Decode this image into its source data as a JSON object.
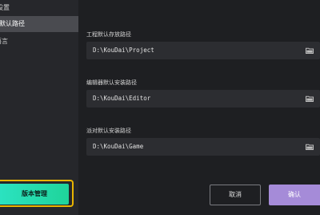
{
  "sidebar": {
    "title": "设置",
    "items": [
      {
        "label": "默认路径",
        "active": true
      },
      {
        "label": "语言",
        "active": false
      }
    ],
    "version_button": "版本管理"
  },
  "main": {
    "fields": [
      {
        "label": "工程默认存放路径",
        "value": "D:\\KouDai\\Project",
        "icon": "folder-icon"
      },
      {
        "label": "编辑器默认安装路径",
        "value": "D:\\KouDai\\Editor",
        "icon": "folder-icon"
      },
      {
        "label": "派对默认安装路径",
        "value": "D:\\KouDai\\Game",
        "icon": "folder-icon"
      }
    ]
  },
  "footer": {
    "cancel_label": "取消",
    "confirm_label": "确认"
  },
  "colors": {
    "background": "#1e1f22",
    "sidebar": "#26272b",
    "active_item": "#4a4b50",
    "accent_green": "#2be2c0",
    "highlight_border": "#e9b400",
    "confirm": "#a58bd8"
  }
}
